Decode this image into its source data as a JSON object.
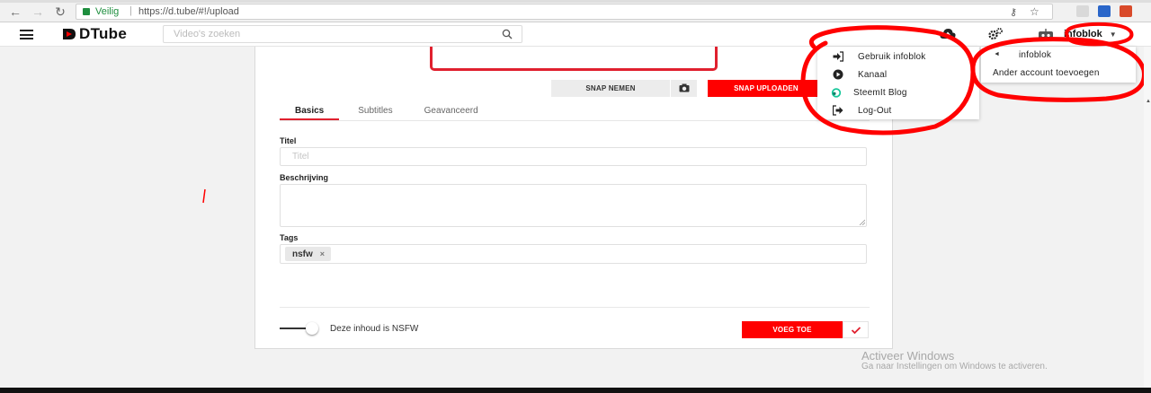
{
  "browser": {
    "secure_label": "Veilig",
    "separator": "|",
    "url": "https://d.tube/#!/upload"
  },
  "header": {
    "logo_text": "DTube",
    "search_placeholder": "Video's zoeken",
    "username": "infoblok"
  },
  "upload": {
    "snap_label": "SNAP NEMEN",
    "snap_upload_label": "SNAP UPLOADEN",
    "tabs": [
      "Basics",
      "Subtitles",
      "Geavanceerd"
    ],
    "active_tab": "Basics",
    "title_label": "Titel",
    "title_placeholder": "Titel",
    "description_label": "Beschrijving",
    "tags_label": "Tags",
    "tags": [
      "nsfw"
    ],
    "tag_remove_glyph": "×",
    "nsfw_label": "Deze inhoud is NSFW",
    "add_label": "VOEG TOE"
  },
  "user_menu": {
    "items": [
      {
        "label": "Gebruik infoblok",
        "icon": "sign-in-icon"
      },
      {
        "label": "Kanaal",
        "icon": "play-circle-icon"
      },
      {
        "label": "SteemIt Blog",
        "icon": "steemit-icon"
      },
      {
        "label": "Log-Out",
        "icon": "sign-out-icon"
      }
    ]
  },
  "account_menu": {
    "caret": "◄",
    "current_account": "infoblok",
    "add_account": "Ander account toevoegen"
  },
  "watermark": {
    "title": "Activeer Windows",
    "subtitle": "Ga naar Instellingen om Windows te activeren."
  },
  "colors": {
    "brand_red": "#ff0000",
    "annotation_red": "#ff0000",
    "secure_green": "#1e8e3e"
  }
}
